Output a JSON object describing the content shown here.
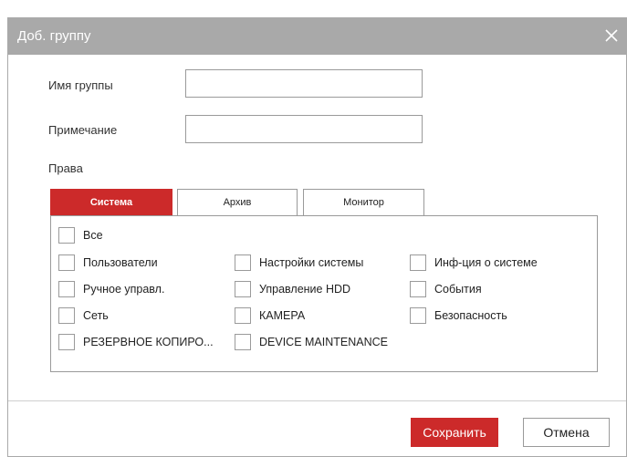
{
  "dialog": {
    "title": "Доб. группу",
    "close_icon": "close-icon"
  },
  "form": {
    "group_name_label": "Имя группы",
    "group_name_value": "",
    "note_label": "Примечание",
    "note_value": "",
    "rights_label": "Права"
  },
  "tabs": [
    {
      "label": "Система",
      "active": true
    },
    {
      "label": "Архив",
      "active": false
    },
    {
      "label": "Монитор",
      "active": false
    }
  ],
  "permissions": {
    "all": {
      "label": "Все",
      "checked": false
    },
    "items": [
      {
        "label": "Пользователи",
        "checked": false
      },
      {
        "label": "Настройки системы",
        "checked": false
      },
      {
        "label": "Инф-ция о системе",
        "checked": false
      },
      {
        "label": "Ручное управл.",
        "checked": false
      },
      {
        "label": "Управление HDD",
        "checked": false
      },
      {
        "label": "События",
        "checked": false
      },
      {
        "label": "Сеть",
        "checked": false
      },
      {
        "label": "КАМЕРА",
        "checked": false
      },
      {
        "label": "Безопасность",
        "checked": false
      },
      {
        "label": "РЕЗЕРВНОЕ КОПИРО...",
        "checked": false
      },
      {
        "label": "DEVICE MAINTENANCE",
        "checked": false
      }
    ]
  },
  "buttons": {
    "save": "Сохранить",
    "cancel": "Отмена"
  },
  "colors": {
    "accent": "#cc2a2a",
    "titlebar": "#a9a9a9",
    "border": "#9a9a9a"
  }
}
